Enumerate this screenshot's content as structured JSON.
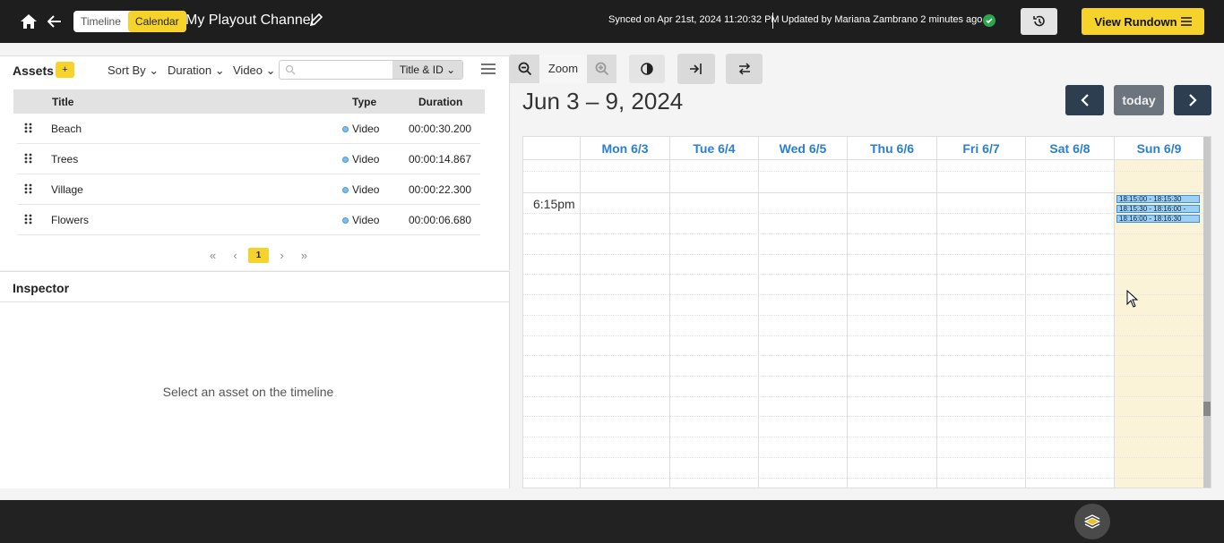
{
  "topbar": {
    "view_toggle": [
      "Timeline",
      "Calendar"
    ],
    "active_view": "Calendar",
    "channel_title": "My Playout Channel",
    "sync_info": "Synced on Apr 21st, 2024 11:20:32 PM",
    "update_info": "Updated by Mariana Zambrano 2 minutes ago",
    "rundown_label": "View Rundown"
  },
  "assets": {
    "title": "Assets",
    "add_label": "+",
    "filters": {
      "sort_by": "Sort By",
      "duration": "Duration",
      "type": "Video"
    },
    "search": {
      "value": "",
      "scope": "Title & ID"
    },
    "columns": {
      "title": "Title",
      "type": "Type",
      "duration": "Duration"
    },
    "rows": [
      {
        "title": "Beach",
        "type": "Video",
        "duration": "00:00:30.200"
      },
      {
        "title": "Trees",
        "type": "Video",
        "duration": "00:00:14.867"
      },
      {
        "title": "Village",
        "type": "Video",
        "duration": "00:00:22.300"
      },
      {
        "title": "Flowers",
        "type": "Video",
        "duration": "00:00:06.680"
      }
    ],
    "pagination": {
      "current": "1"
    }
  },
  "inspector": {
    "title": "Inspector",
    "empty_text": "Select an asset on the timeline"
  },
  "calendar": {
    "zoom_label": "Zoom",
    "date_range": "Jun 3 – 9, 2024",
    "today_label": "today",
    "days": [
      "Mon 6/3",
      "Tue 6/4",
      "Wed 6/5",
      "Thu 6/6",
      "Fri 6/7",
      "Sat 6/8",
      "Sun 6/9"
    ],
    "today_index": 6,
    "time_label": "6:15pm",
    "events": [
      {
        "label": "18:15:00 - 18:15:30"
      },
      {
        "label": "18:15:30 - 18:16:00 -"
      },
      {
        "label": "18:16:00 - 18:16:30"
      }
    ]
  },
  "colors": {
    "accent": "#f5d32a",
    "topbar_bg": "#1e1e1e",
    "day_header": "#2a7fd4",
    "today_bg": "#fbf3d7",
    "event_bg": "#9fd0f3",
    "nav_btn": "#2c3e50",
    "synced_ok": "#2ea44f"
  },
  "icons": {
    "home": "home-icon",
    "back": "arrow-left-icon",
    "edit": "pencil-icon",
    "synced": "check-circle-icon",
    "history": "history-icon",
    "rundown": "menu-lines-icon",
    "zoom_out": "zoom-out-icon",
    "zoom_in": "zoom-in-icon",
    "contrast": "contrast-icon",
    "goto_now": "login-arrow-icon",
    "swap": "swap-arrows-icon",
    "bottom": "layers-icon"
  }
}
